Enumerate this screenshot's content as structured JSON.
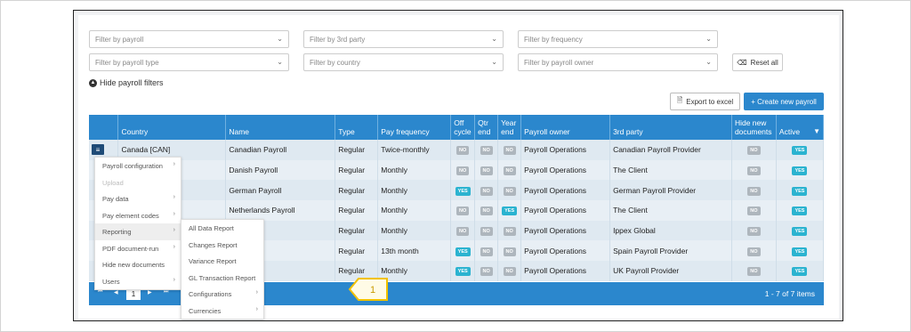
{
  "filters": {
    "row1": [
      {
        "placeholder": "Filter by payroll"
      },
      {
        "placeholder": "Filter by 3rd party"
      },
      {
        "placeholder": "Filter by frequency"
      }
    ],
    "row2": [
      {
        "placeholder": "Filter by payroll type"
      },
      {
        "placeholder": "Filter by country"
      },
      {
        "placeholder": "Filter by payroll owner"
      }
    ],
    "reset_label": "Reset all",
    "hide_label": "Hide payroll filters"
  },
  "actions": {
    "export_label": "Export to excel",
    "new_label": "+ Create new payroll"
  },
  "table": {
    "headers": {
      "country": "Country",
      "name": "Name",
      "type": "Type",
      "frequency": "Pay frequency",
      "off_cycle": [
        "Off",
        "cycle"
      ],
      "qtr_end": [
        "Qtr",
        "end"
      ],
      "year_end": [
        "Year",
        "end"
      ],
      "owner": "Payroll owner",
      "third_party": "3rd party",
      "hide_docs": [
        "Hide new",
        "documents"
      ],
      "active": "Active"
    },
    "rows": [
      {
        "country": "Canada [CAN]",
        "name": "Canadian Payroll",
        "type": "Regular",
        "frequency": "Twice-monthly",
        "off_cycle": "NO",
        "qtr_end": "NO",
        "year_end": "NO",
        "owner": "Payroll Operations",
        "third_party": "Canadian Payroll Provider",
        "hide_docs": "NO",
        "active": "YES"
      },
      {
        "country": "",
        "name": "Danish Payroll",
        "type": "Regular",
        "frequency": "Monthly",
        "off_cycle": "NO",
        "qtr_end": "NO",
        "year_end": "NO",
        "owner": "Payroll Operations",
        "third_party": "The Client",
        "hide_docs": "NO",
        "active": "YES"
      },
      {
        "country": "",
        "name": "German Payroll",
        "type": "Regular",
        "frequency": "Monthly",
        "off_cycle": "YES",
        "qtr_end": "NO",
        "year_end": "NO",
        "owner": "Payroll Operations",
        "third_party": "German Payroll Provider",
        "hide_docs": "NO",
        "active": "YES"
      },
      {
        "country": "D]",
        "name": "Netherlands Payroll",
        "type": "Regular",
        "frequency": "Monthly",
        "off_cycle": "NO",
        "qtr_end": "NO",
        "year_end": "YES",
        "owner": "Payroll Operations",
        "third_party": "The Client",
        "hide_docs": "NO",
        "active": "YES"
      },
      {
        "country": "",
        "name": "",
        "type": "Regular",
        "frequency": "Monthly",
        "off_cycle": "NO",
        "qtr_end": "NO",
        "year_end": "NO",
        "owner": "Payroll Operations",
        "third_party": "Ippex Global",
        "hide_docs": "NO",
        "active": "YES"
      },
      {
        "country": "",
        "name": "yroll",
        "type": "Regular",
        "frequency": "13th month",
        "off_cycle": "YES",
        "qtr_end": "NO",
        "year_end": "NO",
        "owner": "Payroll Operations",
        "third_party": "Spain Payroll Provider",
        "hide_docs": "NO",
        "active": "YES"
      },
      {
        "country": "",
        "name": "gdo",
        "type": "Regular",
        "frequency": "Monthly",
        "off_cycle": "YES",
        "qtr_end": "NO",
        "year_end": "NO",
        "owner": "Payroll Operations",
        "third_party": "UK Payroll Provider",
        "hide_docs": "NO",
        "active": "YES"
      }
    ]
  },
  "pager": {
    "current_page": "1",
    "info": "1 - 7 of 7 items",
    "first": "⏮",
    "prev": "◀",
    "next": "▶",
    "last": "⏭"
  },
  "context_menu": {
    "items": [
      {
        "label": "Payroll configuration",
        "submenu": true,
        "disabled": false,
        "active": false
      },
      {
        "label": "Upload",
        "submenu": false,
        "disabled": true,
        "active": false
      },
      {
        "label": "Pay data",
        "submenu": true,
        "disabled": false,
        "active": false
      },
      {
        "label": "Pay element codes",
        "submenu": true,
        "disabled": false,
        "active": false
      },
      {
        "label": "Reporting",
        "submenu": true,
        "disabled": false,
        "active": true
      },
      {
        "label": "PDF document-run",
        "submenu": true,
        "disabled": false,
        "active": false
      },
      {
        "label": "Hide new documents",
        "submenu": false,
        "disabled": false,
        "active": false
      },
      {
        "label": "Users",
        "submenu": true,
        "disabled": false,
        "active": false
      }
    ]
  },
  "submenu": {
    "items": [
      {
        "label": "All Data Report",
        "submenu": false
      },
      {
        "label": "Changes Report",
        "submenu": false
      },
      {
        "label": "Variance Report",
        "submenu": false
      },
      {
        "label": "GL Transaction Report",
        "submenu": false
      },
      {
        "label": "Configurations",
        "submenu": true
      },
      {
        "label": "Currencies",
        "submenu": true
      }
    ]
  },
  "callout": {
    "label": "1",
    "color": "#f2c200"
  },
  "colors": {
    "header_blue": "#2b87cd",
    "yes_badge": "#2bb3d0",
    "no_badge": "#aeb6bd",
    "menu_btn": "#1f4b77"
  }
}
